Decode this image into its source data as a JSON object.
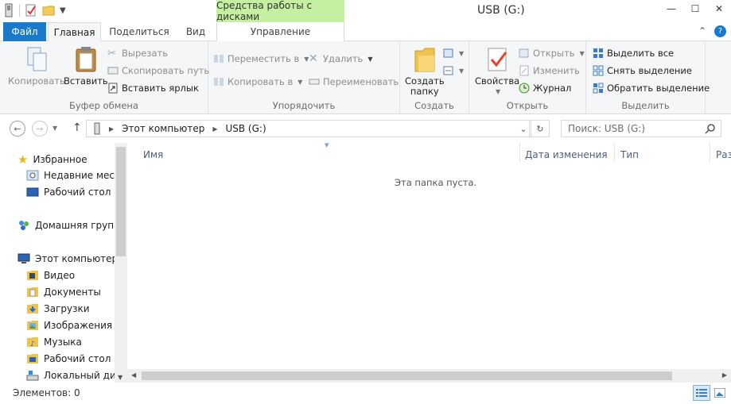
{
  "window": {
    "title": "USB (G:)",
    "contextual_tab_header": "Средства работы с дисками"
  },
  "tabs": {
    "file": "Файл",
    "home": "Главная",
    "share": "Поделиться",
    "view": "Вид",
    "manage": "Управление"
  },
  "ribbon": {
    "clipboard": {
      "label": "Буфер обмена",
      "copy": "Копировать",
      "paste": "Вставить",
      "cut": "Вырезать",
      "copy_path": "Скопировать путь",
      "paste_shortcut": "Вставить ярлык"
    },
    "organize": {
      "label": "Упорядочить",
      "move_to": "Переместить в",
      "copy_to": "Копировать в",
      "delete": "Удалить",
      "rename": "Переименовать"
    },
    "create": {
      "label": "Создать",
      "new_folder_line1": "Создать",
      "new_folder_line2": "папку"
    },
    "open": {
      "label": "Открыть",
      "properties": "Свойства",
      "open": "Открыть",
      "edit": "Изменить",
      "history": "Журнал"
    },
    "select": {
      "label": "Выделить",
      "select_all": "Выделить все",
      "select_none": "Снять выделение",
      "invert": "Обратить выделение"
    }
  },
  "address": {
    "crumbs": [
      "Этот компьютер",
      "USB (G:)"
    ],
    "search_placeholder": "Поиск: USB (G:)"
  },
  "nav_pane": {
    "favorites": "Избранное",
    "recent": "Недавние места",
    "desktop_fav": "Рабочий стол",
    "homegroup": "Домашняя группа",
    "this_pc": "Этот компьютер",
    "video": "Видео",
    "documents": "Документы",
    "downloads": "Загрузки",
    "images": "Изображения",
    "music": "Музыка",
    "desktop": "Рабочий стол",
    "local_disk": "Локальный диск"
  },
  "columns": {
    "name": "Имя",
    "date": "Дата изменения",
    "type": "Тип",
    "size": "Разм"
  },
  "content": {
    "empty_message": "Эта папка пуста."
  },
  "status": {
    "items": "Элементов: 0"
  }
}
